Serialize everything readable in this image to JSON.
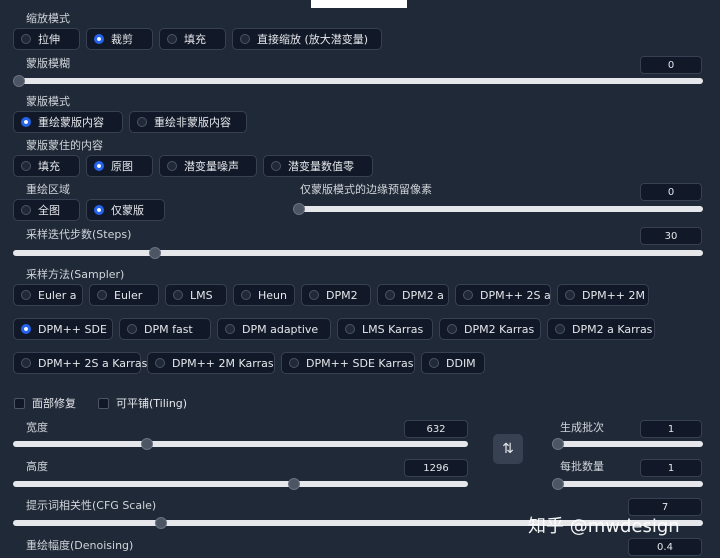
{
  "resize_mode": {
    "label": "缩放模式",
    "options": [
      "拉伸",
      "裁剪",
      "填充",
      "直接缩放 (放大潜变量)"
    ],
    "selected": 1
  },
  "mask_blur": {
    "label": "蒙版模糊",
    "value": "0",
    "fraction": 0.0
  },
  "mask_mode": {
    "label": "蒙版模式",
    "options": [
      "重绘蒙版内容",
      "重绘非蒙版内容"
    ],
    "selected": 0
  },
  "masked_content": {
    "label": "蒙版蒙住的内容",
    "options": [
      "填充",
      "原图",
      "潜变量噪声",
      "潜变量数值零"
    ],
    "selected": 1
  },
  "inpaint_area": {
    "label": "重绘区域",
    "options": [
      "全图",
      "仅蒙版"
    ],
    "selected": 1
  },
  "only_masked_padding": {
    "label": "仅蒙版模式的边缘预留像素",
    "value": "0",
    "fraction": 0.0
  },
  "steps": {
    "label": "采样迭代步数(Steps)",
    "value": "30",
    "fraction": 0.2
  },
  "sampler": {
    "label": "采样方法(Sampler)",
    "row1": [
      "Euler a",
      "Euler",
      "LMS",
      "Heun",
      "DPM2",
      "DPM2 a",
      "DPM++ 2S a",
      "DPM++ 2M"
    ],
    "row2": [
      "DPM++ SDE",
      "DPM fast",
      "DPM adaptive",
      "LMS Karras",
      "DPM2 Karras",
      "DPM2 a Karras"
    ],
    "row3": [
      "DPM++ 2S a Karras",
      "DPM++ 2M Karras",
      "DPM++ SDE Karras",
      "DDIM"
    ],
    "selected": "DPM++ SDE"
  },
  "checkboxes": {
    "face_restore": "面部修复",
    "tiling": "可平铺(Tiling)"
  },
  "width": {
    "label": "宽度",
    "value": "632",
    "fraction": 0.29
  },
  "height": {
    "label": "高度",
    "value": "1296",
    "fraction": 0.62
  },
  "batch_count": {
    "label": "生成批次",
    "value": "1",
    "fraction": 0.0
  },
  "batch_size": {
    "label": "每批数量",
    "value": "1",
    "fraction": 0.0
  },
  "cfg_scale": {
    "label": "提示词相关性(CFG Scale)",
    "value": "7",
    "fraction": 0.21
  },
  "denoising": {
    "label": "重绘幅度(Denoising)",
    "value": "0.4",
    "fraction": 0.4
  },
  "swap_icon": "swap-arrows-icon",
  "watermark": "知乎 @mwdesign",
  "colors": {
    "accent": "#2563eb",
    "background": "#1f2937",
    "control": "#111827"
  }
}
